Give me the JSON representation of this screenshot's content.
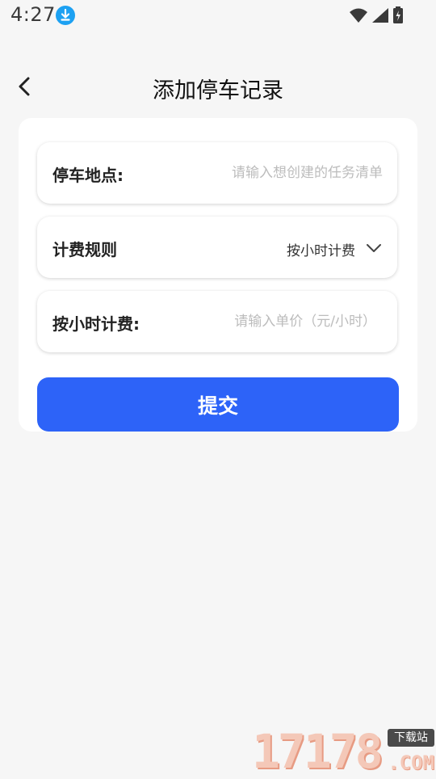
{
  "status_bar": {
    "time": "4:27",
    "icons": [
      "download-icon",
      "wifi-icon",
      "signal-icon",
      "battery-charging-icon"
    ]
  },
  "header": {
    "title": "添加停车记录",
    "back_icon": "chevron-left-icon"
  },
  "form": {
    "location": {
      "label": "停车地点:",
      "placeholder": "请输入想创建的任务清单",
      "value": ""
    },
    "billing_rule": {
      "label": "计费规则",
      "value": "按小时计费",
      "icon": "chevron-down-icon"
    },
    "hourly_rate": {
      "label": "按小时计费:",
      "placeholder": "请输入单价（元/小时）",
      "value": ""
    },
    "submit_label": "提交"
  },
  "watermark": {
    "digits": "17178",
    "badge": "下载站",
    "suffix": ".COM"
  },
  "colors": {
    "background": "#f6f6f6",
    "card": "#ffffff",
    "primary": "#2d63f8",
    "placeholder": "#bcbcbc",
    "status_download": "#1da1f2"
  }
}
